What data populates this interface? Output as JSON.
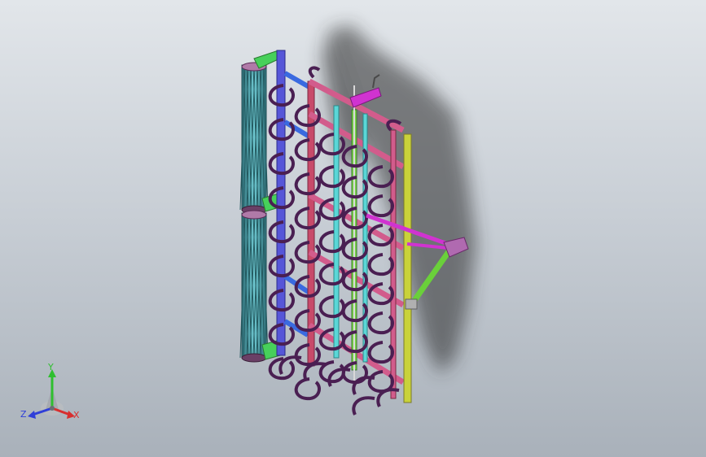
{
  "viewport": {
    "background_top": "#e2e6ea",
    "background_bottom": "#a9b1ba"
  },
  "model": {
    "name": "cultivator-harrow-assembly",
    "tine_color": "#4a1f52",
    "part_colors": {
      "roller": "#5fb7c0",
      "roller_bracket": "#47d05a",
      "rear_bar": "#5656d8",
      "frame_pink": "#d25c8c",
      "frame_red": "#c84a6a",
      "cyan_bar": "#5ad7d7",
      "green_bar": "#7ad44a",
      "yellow_bar": "#c9d23a",
      "hitch_magenta": "#d033d0",
      "hitch_green": "#6ad03a",
      "hitch_plate": "#b06ab0"
    }
  },
  "triad": {
    "y_label": "Y",
    "z_label": "Z",
    "x_label": "X",
    "y_color": "#2fbf2f",
    "z_color": "#2f3fd8",
    "x_color": "#d82f2f"
  }
}
